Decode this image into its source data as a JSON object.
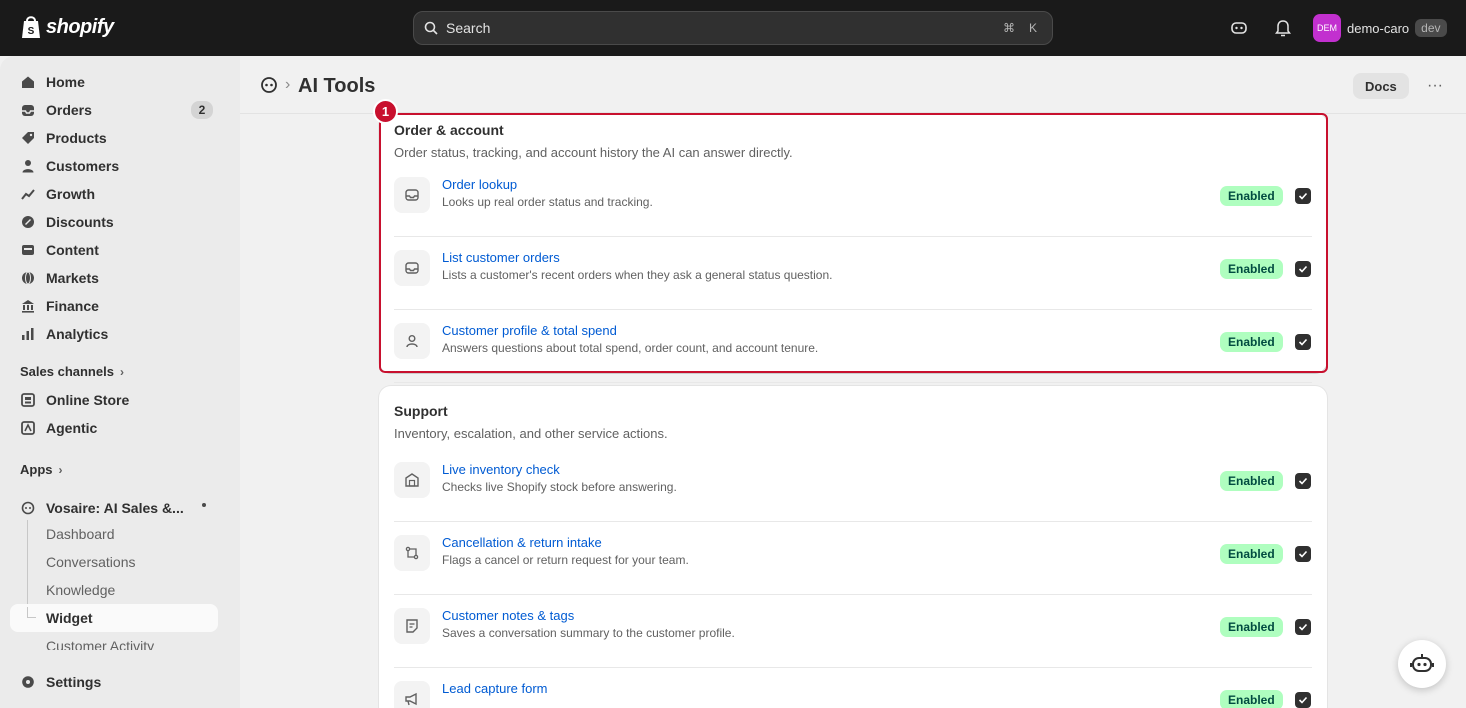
{
  "app": {
    "brand": "shopify"
  },
  "search": {
    "placeholder": "Search",
    "shortcut_cmd": "⌘",
    "shortcut_key": "K"
  },
  "user": {
    "initials": "DEM",
    "store": "demo-caro",
    "env": "dev"
  },
  "sidebar": {
    "items": [
      {
        "label": "Home",
        "icon": "home-icon"
      },
      {
        "label": "Orders",
        "icon": "orders-icon",
        "count": "2"
      },
      {
        "label": "Products",
        "icon": "tag-icon"
      },
      {
        "label": "Customers",
        "icon": "person-icon"
      },
      {
        "label": "Growth",
        "icon": "growth-icon"
      },
      {
        "label": "Discounts",
        "icon": "discount-icon"
      },
      {
        "label": "Content",
        "icon": "content-icon"
      },
      {
        "label": "Markets",
        "icon": "globe-icon"
      },
      {
        "label": "Finance",
        "icon": "bank-icon"
      },
      {
        "label": "Analytics",
        "icon": "chart-icon"
      }
    ],
    "sales_channels_label": "Sales channels",
    "channels": [
      {
        "label": "Online Store",
        "icon": "store-icon"
      },
      {
        "label": "Agentic",
        "icon": "agentic-icon"
      }
    ],
    "apps_label": "Apps",
    "app_name": "Vosaire: AI Sales &...",
    "app_subitems": [
      "Dashboard",
      "Conversations",
      "Knowledge",
      "Widget",
      "Customer Activity"
    ],
    "settings_label": "Settings"
  },
  "header": {
    "title": "AI Tools",
    "docs_label": "Docs",
    "more_label": "···"
  },
  "annotation": {
    "marker": "1"
  },
  "sections": [
    {
      "title": "Order & account",
      "subtitle": "Order status, tracking, and account history the AI can answer directly.",
      "tools": [
        {
          "name": "Order lookup",
          "desc": "Looks up real order status and tracking.",
          "status": "Enabled",
          "icon": "inbox-icon"
        },
        {
          "name": "List customer orders",
          "desc": "Lists a customer's recent orders when they ask a general status question.",
          "status": "Enabled",
          "icon": "inbox-icon"
        },
        {
          "name": "Customer profile & total spend",
          "desc": "Answers questions about total spend, order count, and account tenure.",
          "status": "Enabled",
          "icon": "person-icon"
        }
      ]
    },
    {
      "title": "Support",
      "subtitle": "Inventory, escalation, and other service actions.",
      "tools": [
        {
          "name": "Live inventory check",
          "desc": "Checks live Shopify stock before answering.",
          "status": "Enabled",
          "icon": "warehouse-icon"
        },
        {
          "name": "Cancellation & return intake",
          "desc": "Flags a cancel or return request for your team.",
          "status": "Enabled",
          "icon": "return-icon"
        },
        {
          "name": "Customer notes & tags",
          "desc": "Saves a conversation summary to the customer profile.",
          "status": "Enabled",
          "icon": "note-icon"
        },
        {
          "name": "Lead capture form",
          "desc": "",
          "status": "Enabled",
          "icon": "megaphone-icon"
        }
      ]
    }
  ]
}
